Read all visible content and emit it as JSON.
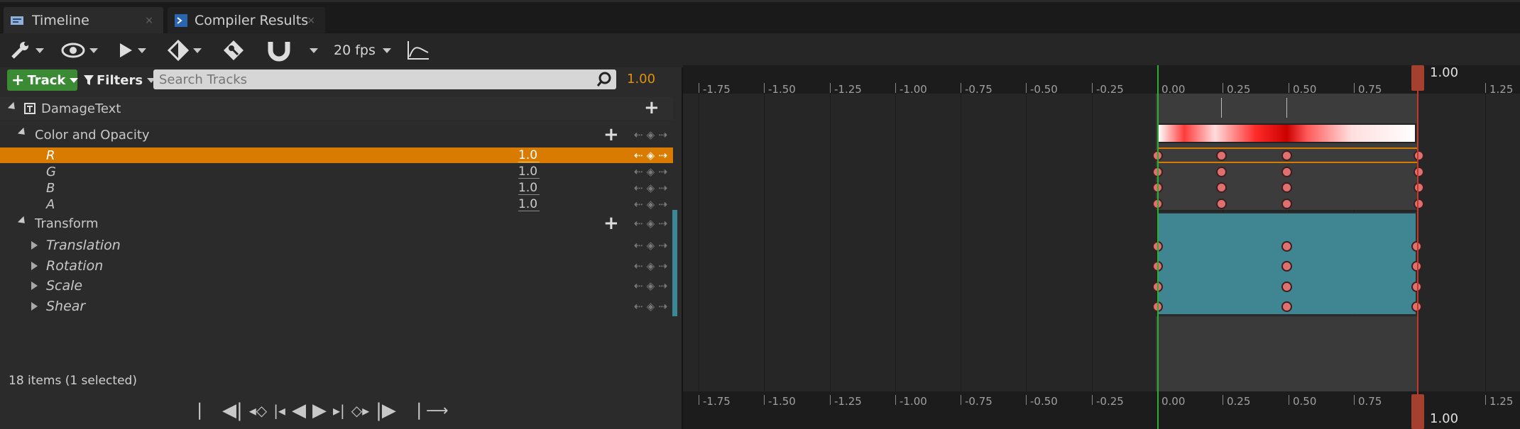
{
  "tabs": [
    {
      "label": "Timeline",
      "close": "×"
    },
    {
      "label": "Compiler Results",
      "close": "×"
    }
  ],
  "toolbar": {
    "fps": "20 fps",
    "icons": [
      "wrench-icon",
      "eye-icon",
      "play-icon",
      "keyframe-icon",
      "key-icon",
      "magnet-icon",
      "curve-editor-icon"
    ]
  },
  "filterbar": {
    "add_track": "Track",
    "filters": "Filters",
    "search_placeholder": "Search Tracks",
    "value": "1.00"
  },
  "tracks": {
    "root": "DamageText",
    "color_group": "Color and Opacity",
    "channels": [
      {
        "label": "R",
        "value": "1.0"
      },
      {
        "label": "G",
        "value": "1.0"
      },
      {
        "label": "B",
        "value": "1.0"
      },
      {
        "label": "A",
        "value": "1.0"
      }
    ],
    "transform_group": "Transform",
    "transform_items": [
      "Translation",
      "Rotation",
      "Scale",
      "Shear"
    ]
  },
  "status": "18 items (1 selected)",
  "ruler": {
    "ticks": [
      "-1.75",
      "-1.50",
      "-1.25",
      "-1.00",
      "-0.75",
      "-0.50",
      "-0.25",
      "0.00",
      "0.25",
      "0.50",
      "0.75",
      "1.25"
    ],
    "end_label": "1.00"
  },
  "colors": {
    "accent": "#e0920e",
    "teal": "#3f8692",
    "add_track": "#3b8a34",
    "selection": "#d97b00"
  }
}
